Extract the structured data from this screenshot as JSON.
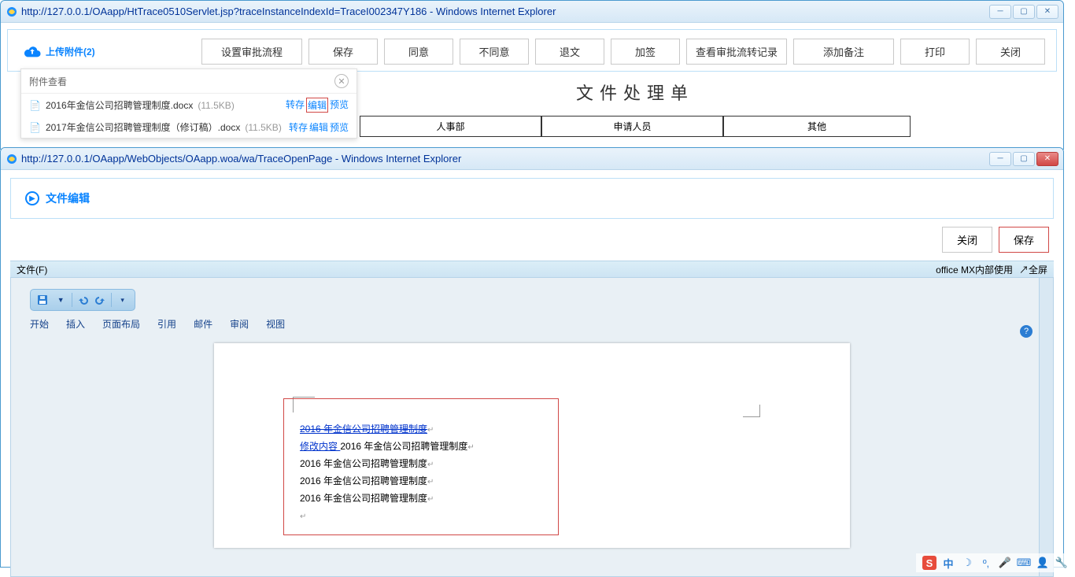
{
  "win1": {
    "title": "http://127.0.0.1/OAapp/HtTrace0510Servlet.jsp?traceInstanceIndexId=TraceI002347Y186 - Windows Internet Explorer",
    "upload_label": "上传附件(2)",
    "buttons": {
      "b0": "设置审批流程",
      "b1": "保存",
      "b2": "同意",
      "b3": "不同意",
      "b4": "退文",
      "b5": "加签",
      "b6": "查看审批流转记录",
      "b7": "添加备注",
      "b8": "打印",
      "b9": "关闭"
    },
    "attach": {
      "title": "附件查看",
      "rows": [
        {
          "name": "2016年金信公司招聘管理制度.docx",
          "size": "(11.5KB)",
          "l0": "转存",
          "l1": "编辑",
          "l2": "预览"
        },
        {
          "name": "2017年金信公司招聘管理制度（修订稿）.docx",
          "size": "(11.5KB)",
          "l0": "转存",
          "l1": "编辑",
          "l2": "预览"
        }
      ]
    },
    "doc_title": "文件处理单",
    "doc_cells": {
      "c0": "人事部",
      "c1": "申请人员",
      "c2": "其他"
    }
  },
  "win2": {
    "title": "http://127.0.0.1/OAapp/WebObjects/OAapp.woa/wa/TraceOpenPage - Windows Internet Explorer",
    "header": "文件编辑",
    "btn_close": "关闭",
    "btn_save": "保存",
    "menubar": {
      "file": "文件(F)",
      "brand": "office MX内部使用",
      "fs": "↗全屏"
    },
    "ribbon": {
      "t0": "开始",
      "t1": "插入",
      "t2": "页面布局",
      "t3": "引用",
      "t4": "邮件",
      "t5": "审阅",
      "t6": "视图"
    },
    "doc": {
      "l0": "2016 年金信公司招聘管理制度",
      "l1a": "修改内容 ",
      "l1b": "2016 年金信公司招聘管理制度",
      "l2": "2016 年金信公司招聘管理制度",
      "l3": "2016 年金信公司招聘管理制度",
      "l4": "2016 年金信公司招聘管理制度"
    }
  },
  "tray": {
    "sg": "S",
    "cn": "中"
  }
}
